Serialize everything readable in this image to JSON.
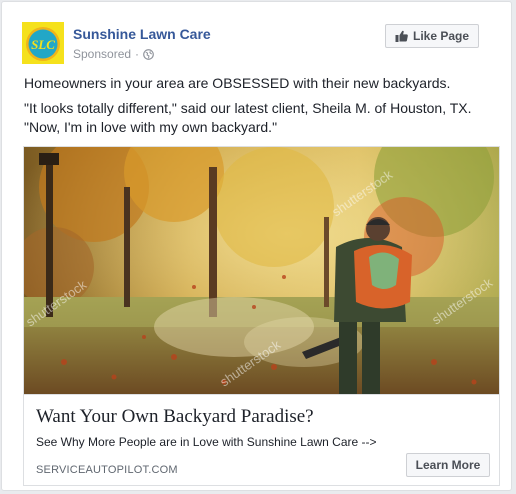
{
  "header": {
    "avatar_text": "SLC",
    "page_name": "Sunshine Lawn Care",
    "sponsored_label": "Sponsored",
    "separator": "·",
    "privacy_icon": "globe-icon",
    "like_button_label": "Like Page",
    "like_icon": "thumbs-up-icon"
  },
  "post": {
    "line1": "Homeowners in your area are OBSESSED with their new backyards.",
    "line2": "\"It looks totally different,\" said our latest client, Sheila M. of Houston, TX.",
    "line3": "\"Now, I'm in love with my own backyard.\""
  },
  "media": {
    "watermark": "shutterstock"
  },
  "link": {
    "headline": "Want Your Own Backyard Paradise?",
    "description": "See Why More People are in Love with Sunshine Lawn Care -->",
    "domain": "SERVICEAUTOPILOT.COM",
    "cta_label": "Learn More"
  },
  "colors": {
    "link_blue": "#365899",
    "avatar_yellow": "#f5e11c",
    "avatar_teal": "#22a7c7",
    "meta_gray": "#90949c"
  }
}
